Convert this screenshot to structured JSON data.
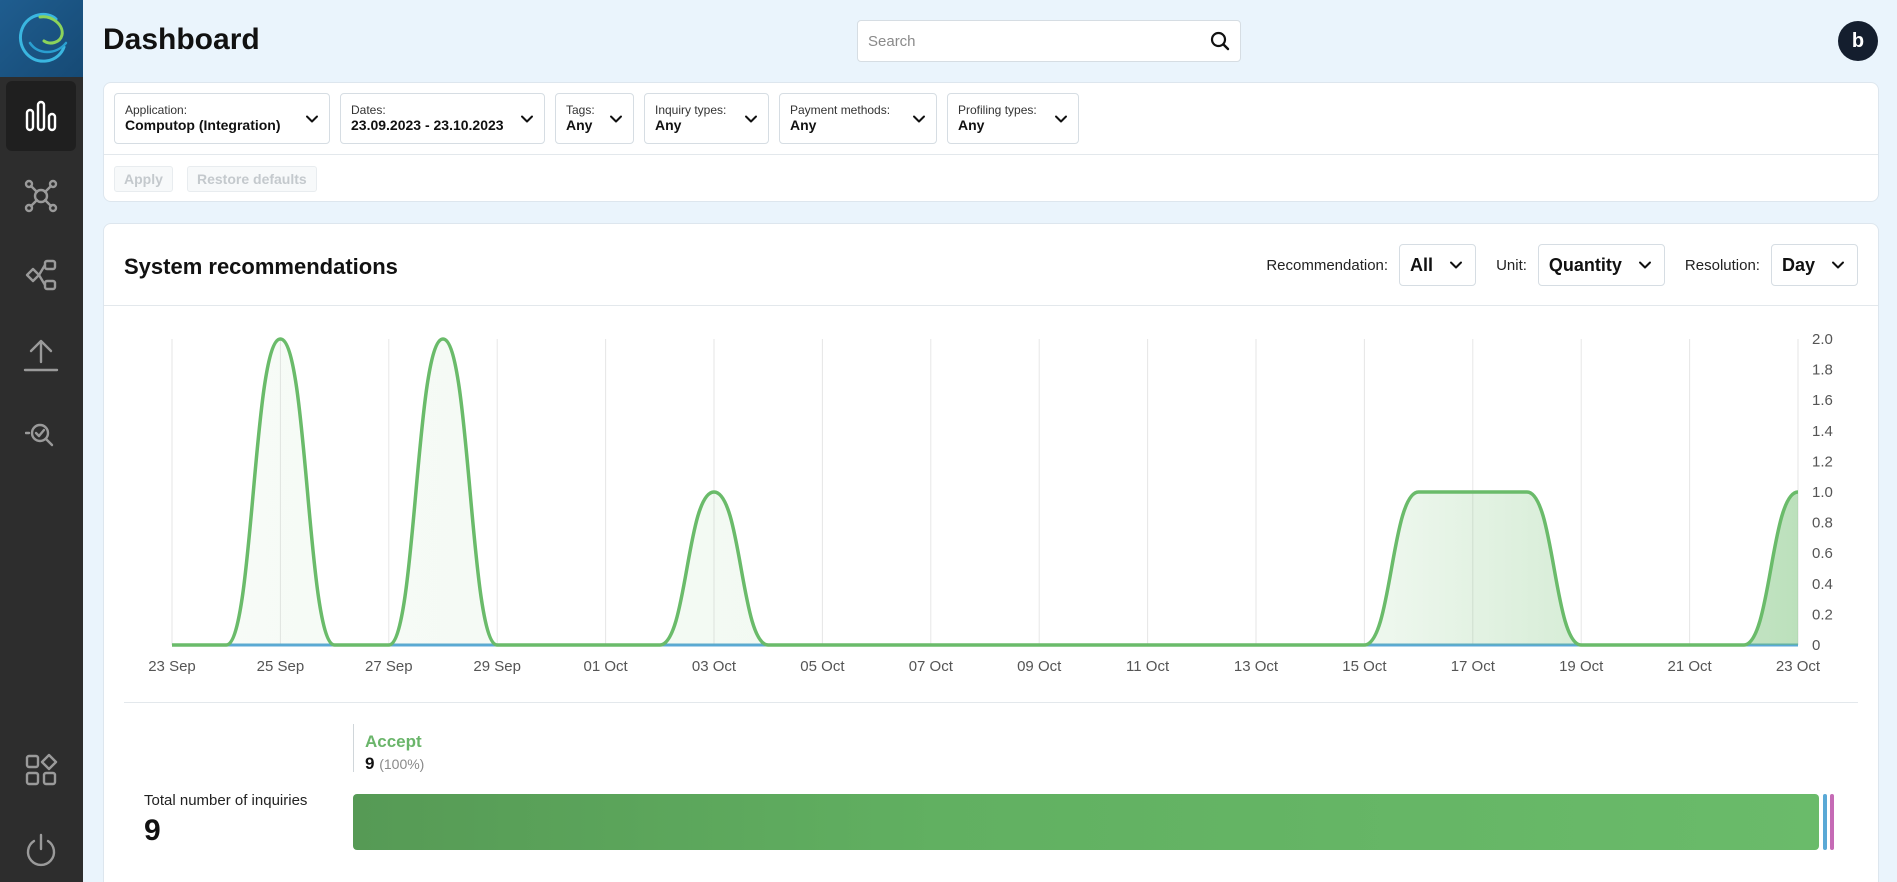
{
  "header": {
    "title": "Dashboard",
    "search_placeholder": "Search",
    "avatar_initial": "b"
  },
  "sidebar": {
    "items": [
      {
        "name": "statistics",
        "icon": "bar-chart-icon",
        "active": true
      },
      {
        "name": "network",
        "icon": "network-icon",
        "active": false
      },
      {
        "name": "workflow",
        "icon": "workflow-icon",
        "active": false
      },
      {
        "name": "upload",
        "icon": "upload-icon",
        "active": false
      },
      {
        "name": "inspect",
        "icon": "search-check-icon",
        "active": false
      },
      {
        "name": "apps",
        "icon": "apps-grid-icon",
        "active": false
      },
      {
        "name": "logout",
        "icon": "power-icon",
        "active": false
      }
    ]
  },
  "filters": {
    "items": [
      {
        "label": "Application:",
        "value": "Computop (Integration)"
      },
      {
        "label": "Dates:",
        "value": "23.09.2023 - 23.10.2023"
      },
      {
        "label": "Tags:",
        "value": "Any"
      },
      {
        "label": "Inquiry types:",
        "value": "Any"
      },
      {
        "label": "Payment methods:",
        "value": "Any"
      },
      {
        "label": "Profiling types:",
        "value": "Any"
      }
    ],
    "apply_label": "Apply",
    "restore_label": "Restore defaults"
  },
  "recommendations": {
    "title": "System recommendations",
    "recommendation_label": "Recommendation:",
    "recommendation_value": "All",
    "unit_label": "Unit:",
    "unit_value": "Quantity",
    "resolution_label": "Resolution:",
    "resolution_value": "Day"
  },
  "chart_data": {
    "type": "area",
    "title": "",
    "xlabel": "",
    "ylabel": "",
    "ylim": [
      0,
      2.0
    ],
    "y_ticks": [
      "0",
      "0.2",
      "0.4",
      "0.6",
      "0.8",
      "1.0",
      "1.2",
      "1.4",
      "1.6",
      "1.8",
      "2.0"
    ],
    "y_axis_side": "right",
    "grid": "vertical",
    "x_tick_labels": [
      "23 Sep",
      "25 Sep",
      "27 Sep",
      "29 Sep",
      "01 Oct",
      "03 Oct",
      "05 Oct",
      "07 Oct",
      "09 Oct",
      "11 Oct",
      "13 Oct",
      "15 Oct",
      "17 Oct",
      "19 Oct",
      "21 Oct",
      "23 Oct"
    ],
    "x": [
      "23 Sep",
      "24 Sep",
      "25 Sep",
      "26 Sep",
      "27 Sep",
      "28 Sep",
      "29 Sep",
      "30 Sep",
      "01 Oct",
      "02 Oct",
      "03 Oct",
      "04 Oct",
      "05 Oct",
      "06 Oct",
      "07 Oct",
      "08 Oct",
      "09 Oct",
      "10 Oct",
      "11 Oct",
      "12 Oct",
      "13 Oct",
      "14 Oct",
      "15 Oct",
      "16 Oct",
      "17 Oct",
      "18 Oct",
      "19 Oct",
      "20 Oct",
      "21 Oct",
      "22 Oct",
      "23 Oct"
    ],
    "series": [
      {
        "color": "#6abb6a",
        "values": [
          0,
          0,
          2,
          0,
          0,
          2,
          0,
          0,
          0,
          0,
          1,
          0,
          0,
          0,
          0,
          0,
          0,
          0,
          0,
          0,
          0,
          0,
          0,
          1,
          1,
          1,
          0,
          0,
          0,
          0,
          1
        ]
      },
      {
        "color": "#5aa9d6",
        "values": [
          0,
          0,
          0,
          0,
          0,
          0,
          0,
          0,
          0,
          0,
          0,
          0,
          0,
          0,
          0,
          0,
          0,
          0,
          0,
          0,
          0,
          0,
          0,
          0,
          0,
          0,
          0,
          0,
          0,
          0,
          0
        ]
      }
    ]
  },
  "summary": {
    "total_label": "Total number of inquiries",
    "total_value": "9",
    "accept_label": "Accept",
    "accept_count": "9",
    "accept_percent": "(100%)",
    "accept_fraction": 1.0,
    "colors": {
      "accept": "#6abb6a",
      "other_1": "#5aa9d6",
      "other_2": "#c56bb5"
    }
  }
}
